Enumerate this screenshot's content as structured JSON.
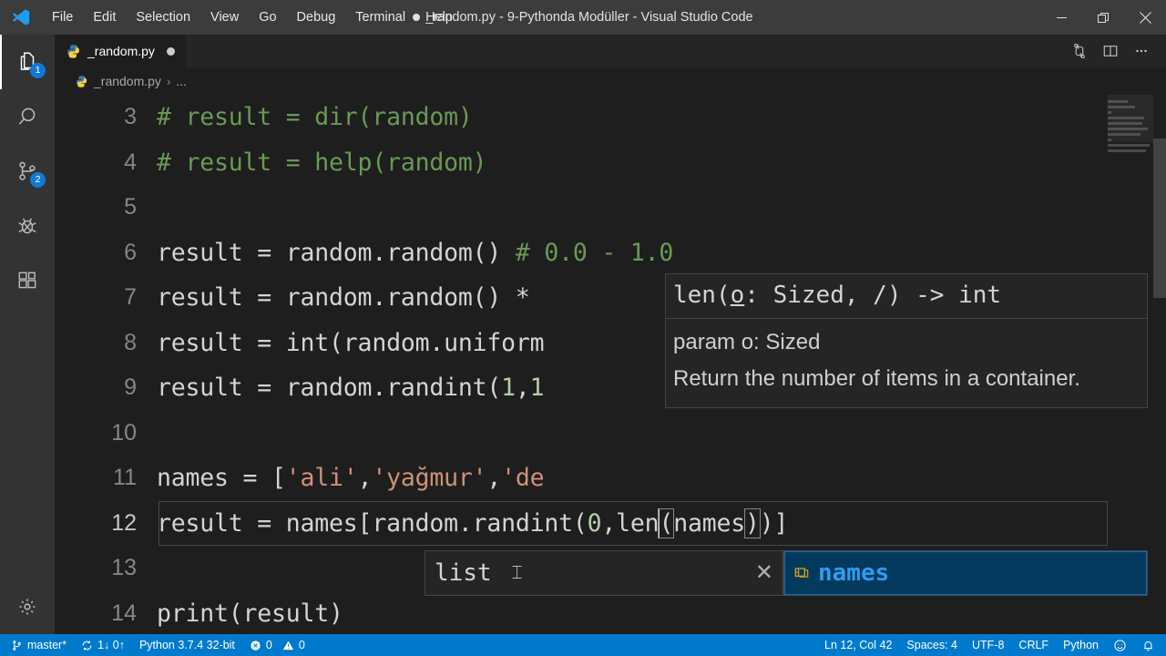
{
  "window": {
    "title": "_random.py - 9-Pythonda Modüller - Visual Studio Code",
    "dirty": true,
    "controls": {
      "minimize": "minimize-icon",
      "restore": "restore-icon",
      "close": "close-icon"
    }
  },
  "menu": {
    "items": [
      "File",
      "Edit",
      "Selection",
      "View",
      "Go",
      "Debug",
      "Terminal",
      "Help"
    ]
  },
  "activitybar": {
    "items": [
      {
        "name": "explorer",
        "icon": "files-icon",
        "badge": "1",
        "active": true
      },
      {
        "name": "search",
        "icon": "search-icon",
        "badge": "",
        "active": false
      },
      {
        "name": "source-control",
        "icon": "source-control-icon",
        "badge": "2",
        "active": false
      },
      {
        "name": "debug",
        "icon": "debug-icon",
        "badge": "",
        "active": false
      },
      {
        "name": "extensions",
        "icon": "extensions-icon",
        "badge": "",
        "active": false
      }
    ],
    "bottom": {
      "name": "manage",
      "icon": "gear-icon"
    }
  },
  "tabs": [
    {
      "label": "_random.py",
      "icon": "python-file-icon",
      "dirty": true,
      "active": true
    }
  ],
  "tabbar_actions": [
    {
      "name": "open-changes",
      "icon": "compare-changes-icon"
    },
    {
      "name": "split-editor",
      "icon": "split-editor-icon"
    },
    {
      "name": "more-actions",
      "icon": "ellipsis-icon"
    }
  ],
  "breadcrumb": {
    "file": "_random.py",
    "separator": "›",
    "more": "..."
  },
  "editor": {
    "current_line": 12,
    "lines": [
      {
        "num": "3",
        "segments": [
          {
            "t": "# result = dir(random)",
            "c": "cmt"
          }
        ]
      },
      {
        "num": "4",
        "segments": [
          {
            "t": "# result = help(random)",
            "c": "cmt"
          }
        ]
      },
      {
        "num": "5",
        "segments": [
          {
            "t": "",
            "c": ""
          }
        ]
      },
      {
        "num": "6",
        "segments": [
          {
            "t": "result = random.random() ",
            "c": ""
          },
          {
            "t": "# 0.0 - 1.0",
            "c": "cmt"
          }
        ]
      },
      {
        "num": "7",
        "segments": [
          {
            "t": "result = random.random() * ",
            "c": ""
          }
        ]
      },
      {
        "num": "8",
        "segments": [
          {
            "t": "result = int(random.uniform",
            "c": ""
          }
        ]
      },
      {
        "num": "9",
        "segments": [
          {
            "t": "result = random.randint(",
            "c": ""
          },
          {
            "t": "1",
            "c": "num"
          },
          {
            "t": ",",
            "c": ""
          },
          {
            "t": "1",
            "c": "num"
          }
        ]
      },
      {
        "num": "10",
        "segments": [
          {
            "t": "",
            "c": ""
          }
        ]
      },
      {
        "num": "11",
        "segments": [
          {
            "t": "names = [",
            "c": ""
          },
          {
            "t": "'ali'",
            "c": "str"
          },
          {
            "t": ",",
            "c": ""
          },
          {
            "t": "'yağmur'",
            "c": "str"
          },
          {
            "t": ",",
            "c": ""
          },
          {
            "t": "'de",
            "c": "str"
          }
        ]
      },
      {
        "num": "12",
        "segments": [
          {
            "t": "result = names[random.randint(",
            "c": ""
          },
          {
            "t": "0",
            "c": "num"
          },
          {
            "t": ",len",
            "c": ""
          }
        ]
      },
      {
        "num": "13",
        "segments": [
          {
            "t": "",
            "c": ""
          }
        ]
      },
      {
        "num": "14",
        "segments": [
          {
            "t": "print(result)",
            "c": ""
          }
        ]
      }
    ],
    "line12_tail": {
      "open_paren": "(",
      "arg": "names",
      "close_paren": ")",
      "rest": ")]"
    }
  },
  "hover": {
    "signature_prefix": "len(",
    "signature_param": "o",
    "signature_suffix": ": Sized, /) -> int",
    "paragraphs": [
      "param o: Sized",
      "Return the number of items in a container."
    ]
  },
  "suggest": {
    "details_text": "list",
    "close_icon": "close-icon",
    "items": [
      {
        "label": "names",
        "icon": "variable-icon",
        "selected": true
      }
    ]
  },
  "statusbar": {
    "left": [
      {
        "name": "branch",
        "icon": "source-control-branch-icon",
        "label": "master*"
      },
      {
        "name": "sync",
        "icon": "sync-icon",
        "label": "1↓ 0↑"
      },
      {
        "name": "python-interpreter",
        "icon": "",
        "label": "Python 3.7.4 32-bit"
      },
      {
        "name": "problems",
        "icon": "error-warning-icon",
        "label": "0   0",
        "errors": "0",
        "warnings": "0"
      }
    ],
    "right": [
      {
        "name": "cursor-position",
        "label": "Ln 12, Col 42"
      },
      {
        "name": "indentation",
        "label": "Spaces: 4"
      },
      {
        "name": "encoding",
        "label": "UTF-8"
      },
      {
        "name": "eol",
        "label": "CRLF"
      },
      {
        "name": "language-mode",
        "label": "Python"
      },
      {
        "name": "feedback",
        "label": "☺"
      },
      {
        "name": "notifications",
        "label": "🔔"
      }
    ]
  },
  "colors": {
    "titlebar_bg": "#3c3c3c",
    "activitybar_bg": "#333333",
    "editor_bg": "#1e1e1e",
    "statusbar_bg": "#007acc",
    "accent": "#0e7ad4",
    "comment": "#6a9955",
    "string": "#ce9178",
    "number": "#b5cea8",
    "suggest_selected_bg": "#04395e"
  }
}
